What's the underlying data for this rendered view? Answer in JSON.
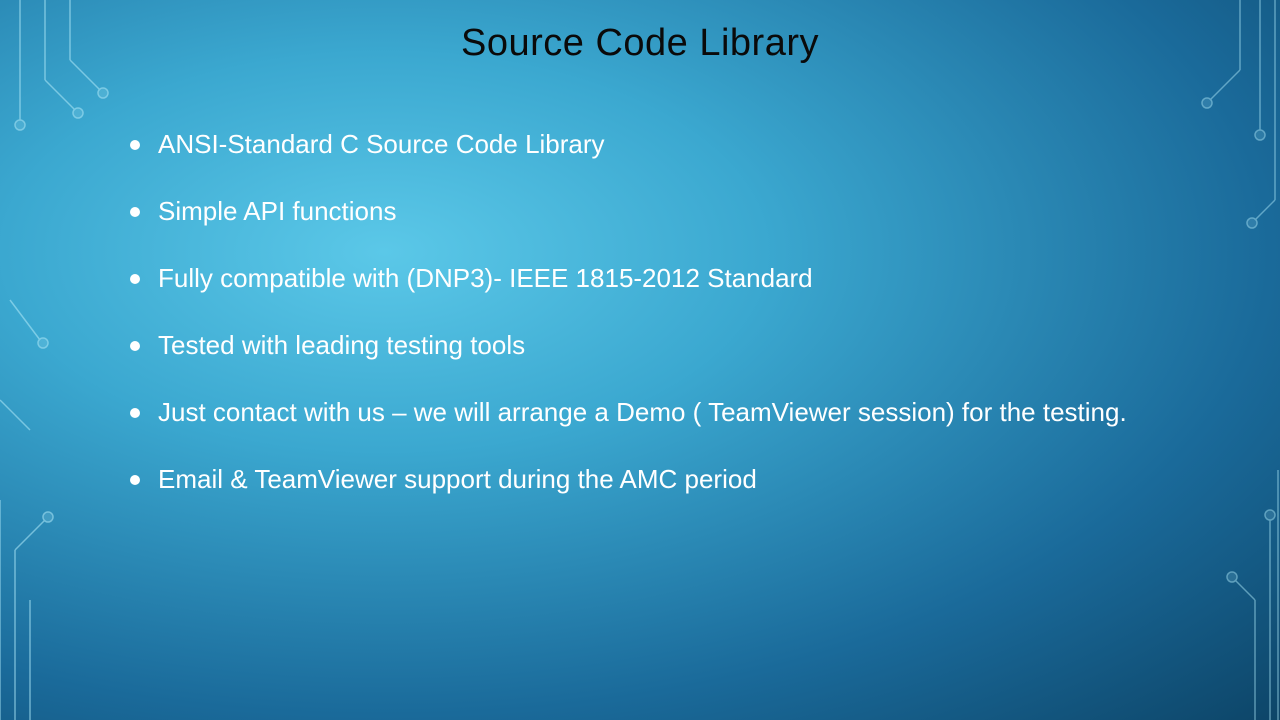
{
  "slide": {
    "title": "Source Code Library",
    "bullets": [
      "ANSI-Standard C Source Code Library",
      "Simple API functions",
      "Fully compatible with (DNP3)- IEEE 1815-2012 Standard",
      "Tested with leading testing tools",
      "Just contact with us – we will arrange a Demo ( TeamViewer session) for the testing.",
      "Email & TeamViewer support during the AMC period"
    ]
  }
}
